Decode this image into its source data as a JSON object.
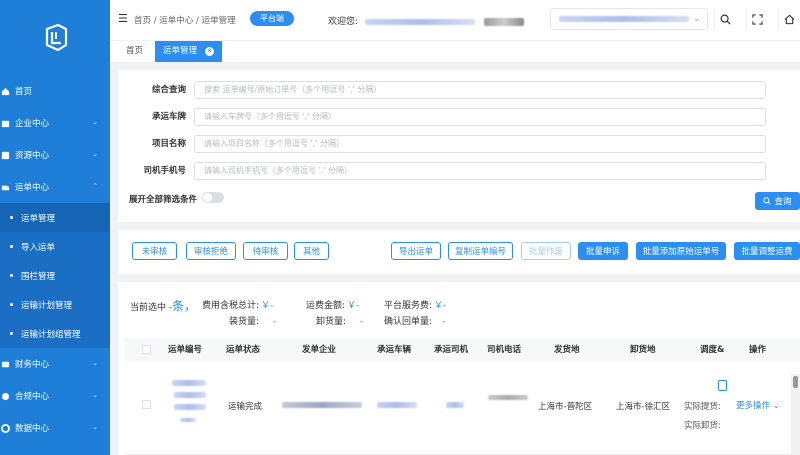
{
  "sidebar": {
    "items": [
      {
        "label": "首页",
        "icon": "home-icon"
      },
      {
        "label": "企业中心",
        "icon": "company-icon"
      },
      {
        "label": "资源中心",
        "icon": "resource-icon"
      },
      {
        "label": "运单中心",
        "icon": "waybill-icon"
      },
      {
        "label": "财务中心",
        "icon": "finance-icon"
      },
      {
        "label": "合规中心",
        "icon": "compliance-icon"
      },
      {
        "label": "数据中心",
        "icon": "data-icon"
      }
    ],
    "sub_items": [
      "运单管理",
      "导入运单",
      "围栏管理",
      "运输计划管理",
      "运输计划组管理"
    ]
  },
  "topbar": {
    "breadcrumb": [
      "首页",
      "运单中心",
      "运单管理"
    ],
    "badge": "平台端",
    "welcome": "欢迎您:"
  },
  "tabs": {
    "home": "首页",
    "active": "运单管理"
  },
  "filter": {
    "rows": [
      {
        "label": "综合查询",
        "placeholder": "搜索 运单编号/原始订单号（多个用逗号 ','  分隔）"
      },
      {
        "label": "承运车牌",
        "placeholder": "请输入车牌号（多个用逗号 ','  分隔）"
      },
      {
        "label": "项目名称",
        "placeholder": "请输入项目名称（多个用逗号 ','  分隔）"
      },
      {
        "label": "司机手机号",
        "placeholder": "请输入司机手机号（多个用逗号 ','  分隔）"
      }
    ],
    "expand_label": "展开全部筛选条件",
    "query_label": "查询"
  },
  "actions": {
    "buttons": [
      "未审核",
      "审核拒绝",
      "待审核",
      "其他",
      "导出运单",
      "复制运单编号",
      "批量作废",
      "批量申诉",
      "批量添加原始运单号",
      "批量调整运费"
    ]
  },
  "summary": {
    "selected_label": "当前选中 -",
    "selected_unit": "条，",
    "fee_label": "费用含税总计:",
    "fee_value": "￥-",
    "freight_label": "运费金额:",
    "freight_value": "￥-",
    "service_label": "平台服务费:",
    "service_value": "￥-",
    "load_label": "装货量:",
    "load_value": "-",
    "unload_label": "卸货量:",
    "unload_value": "-",
    "receipt_label": "确认回单量:",
    "receipt_value": "-"
  },
  "table": {
    "headers": [
      "运单编号",
      "运单状态",
      "发单企业",
      "承运车辆",
      "承运司机",
      "司机电话",
      "发货地",
      "卸货地",
      "调度&",
      "操作"
    ],
    "row": {
      "status": "运输完成",
      "origin": "上海市-普陀区",
      "destination": "上海市-徐汇区",
      "actual_load": "实际提货:",
      "actual_unload": "实际卸货:",
      "more_ops": "更多操作"
    }
  },
  "colors": {
    "primary": "#2b8ef0",
    "sidebar": "#1f7fd8"
  }
}
